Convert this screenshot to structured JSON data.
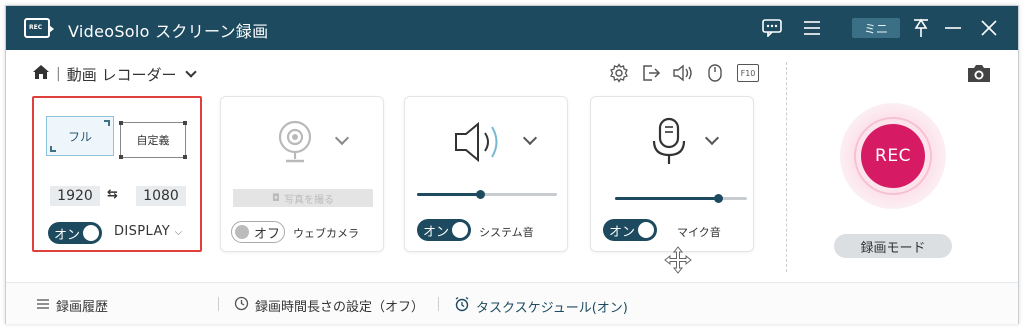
{
  "app": {
    "title": "VideoSolo スクリーン録画",
    "logo_text": "REC",
    "mini_label": "ミニ"
  },
  "titlebar_icons": [
    "feedback-icon",
    "menu-icon",
    "pin-icon",
    "minimize-icon",
    "close-icon"
  ],
  "mode": {
    "label": "動画 レコーダー"
  },
  "toolbar_icons": [
    "gear-icon",
    "export-icon",
    "speaker-icon",
    "mouse-icon",
    "f10-icon"
  ],
  "toolbar_f10_text": "F10",
  "display": {
    "full_label": "フル",
    "custom_label": "自定義",
    "width": "1920",
    "height": "1080",
    "link_symbol": "⇆",
    "toggle_label": "オン",
    "toggle_state": "on",
    "source": "DISPLAY"
  },
  "webcam": {
    "photo_button": "写真を撮る",
    "toggle_label": "オフ",
    "toggle_state": "off",
    "label": "ウェブカメラ"
  },
  "system_audio": {
    "toggle_label": "オン",
    "toggle_state": "on",
    "label": "システム音",
    "volume": 0.45
  },
  "microphone": {
    "toggle_label": "オン",
    "toggle_state": "on",
    "label": "マイク音",
    "volume": 0.78
  },
  "record": {
    "rec_label": "REC",
    "mode_button": "録画モード"
  },
  "footer": {
    "history": "録画履歴",
    "duration": "録画時間長さの設定（オフ）",
    "schedule": "タスクスケジュール(オン)"
  },
  "colors": {
    "titlebar": "#1d4a5f",
    "accent": "#1d4a5f",
    "rec": "#d61a63",
    "selection_border": "#e0403c"
  }
}
